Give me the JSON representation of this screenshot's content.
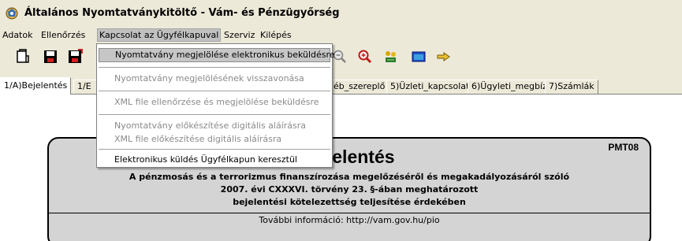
{
  "window": {
    "title": "Általános Nyomtatványkitöltő - Vám- és Pénzügyőrség",
    "icon": "app-logo-icon"
  },
  "menubar": {
    "items": [
      {
        "label": "Adatok"
      },
      {
        "label": "Ellenőrzés"
      },
      {
        "label": "Kapcsolat az Ügyfélkapuval"
      },
      {
        "label": "Szerviz"
      },
      {
        "label": "Kilépés"
      }
    ]
  },
  "dropdown": {
    "items": [
      {
        "label": "Nyomtatvány megjelölése elektronikus beküldésre",
        "state": "highlighted"
      },
      {
        "label": "Nyomtatvány megjelölésének visszavonása",
        "state": "disabled"
      },
      {
        "label": "XML file ellenőrzése és megjelölése beküldésre",
        "state": "disabled"
      },
      {
        "label": "Nyomtatvány előkészítése digitális aláírásra",
        "state": "disabled"
      },
      {
        "label": "XML file előkészítése digitális aláírásra",
        "state": "disabled"
      },
      {
        "label": "Elektronikus küldés Ügyfélkapun keresztül",
        "state": "enabled"
      }
    ]
  },
  "toolbar": {
    "buttons": [
      "open-icon",
      "save-icon",
      "save-as-icon",
      "zoom-out-icon",
      "zoom-in-icon",
      "tools-icon",
      "window-icon",
      "pointer-icon"
    ]
  },
  "tabs": [
    {
      "label": "1/A)Bejelentés",
      "active": true
    },
    {
      "label": "1/E"
    },
    {
      "label": "éb_szereplő"
    },
    {
      "label": "5)Üzleti_kapcsolat"
    },
    {
      "label": "6)Ügyleti_megbíz."
    },
    {
      "label": "7)Számlák"
    }
  ],
  "form": {
    "code": "PMT08",
    "title": "Bejelentés",
    "subtitle_lines": [
      "A pénzmosás és a terrorizmus finanszírozása megelőzéséről és megakadályozásáról szóló",
      "2007. évi CXXXVI. törvény 23. §-ában meghatározott",
      "bejelentési kötelezettség teljesítése érdekében"
    ],
    "info": "További információ: http://vam.gov.hu/pio"
  },
  "colors": {
    "chrome": "#ece9d8",
    "form_panel": "#d4d4d4",
    "menu_highlight": "#c6c6c6",
    "disabled_text": "#8a8a8a"
  }
}
